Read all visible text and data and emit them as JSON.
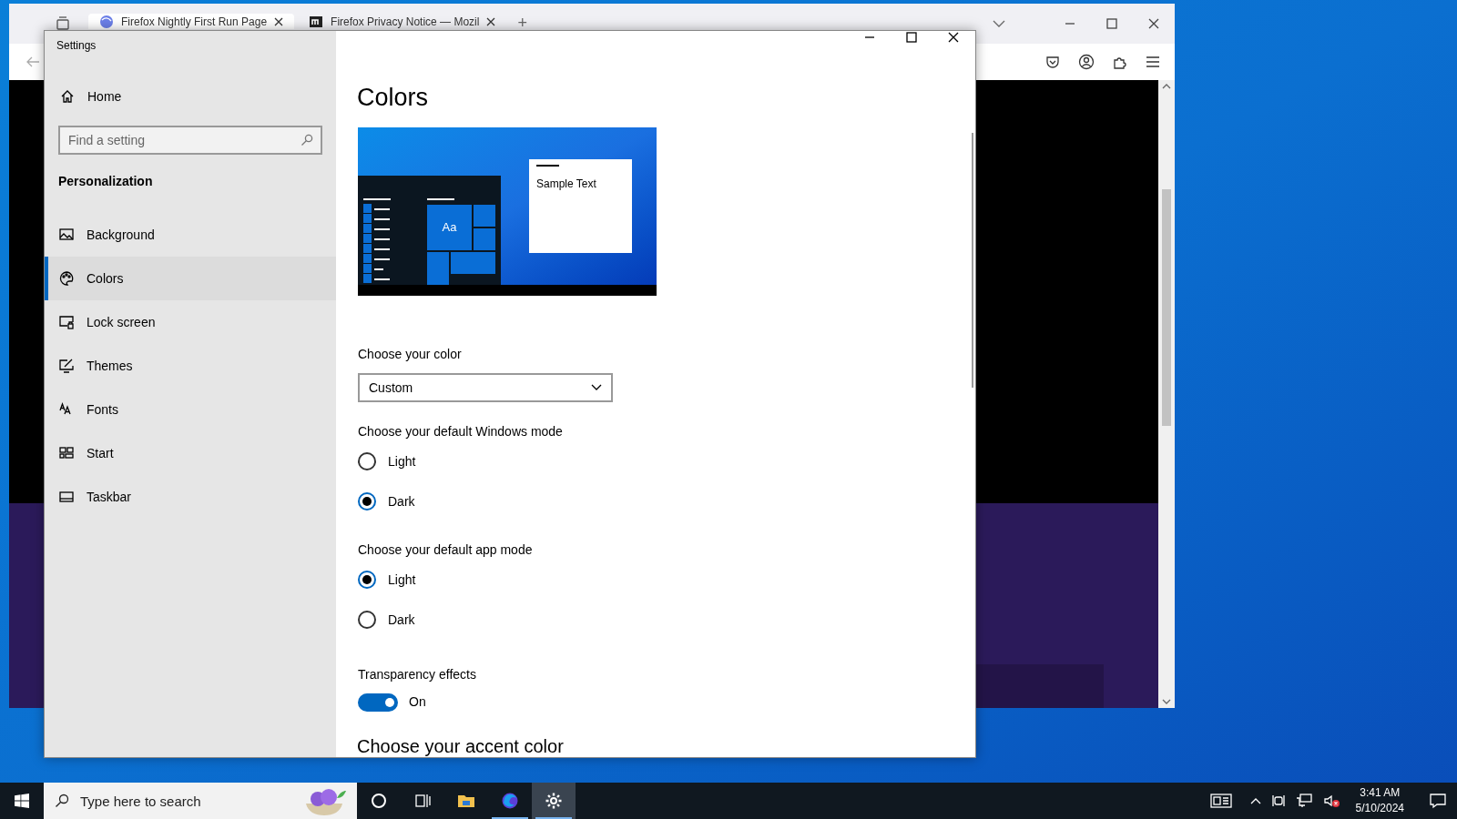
{
  "browser": {
    "tabs": [
      {
        "title": "Firefox Nightly First Run Page",
        "selected": true
      },
      {
        "title": "Firefox Privacy Notice — Mozil",
        "selected": false
      }
    ],
    "new_tab": "+"
  },
  "settings": {
    "title": "Settings",
    "sidebar": {
      "home": "Home",
      "search": {
        "placeholder": "Find a setting"
      },
      "section": "Personalization",
      "items": [
        {
          "label": "Background",
          "kind": "background",
          "selected": false
        },
        {
          "label": "Colors",
          "kind": "colors",
          "selected": true
        },
        {
          "label": "Lock screen",
          "kind": "lock",
          "selected": false
        },
        {
          "label": "Themes",
          "kind": "themes",
          "selected": false
        },
        {
          "label": "Fonts",
          "kind": "fonts",
          "selected": false
        },
        {
          "label": "Start",
          "kind": "start",
          "selected": false
        },
        {
          "label": "Taskbar",
          "kind": "taskbar",
          "selected": false
        }
      ]
    },
    "page": {
      "title": "Colors",
      "preview": {
        "tile_text": "Aa",
        "sample_text": "Sample Text"
      },
      "color_select": {
        "label": "Choose your color",
        "value": "Custom"
      },
      "radio_groups": [
        {
          "label": "Choose your default Windows mode",
          "options": [
            {
              "label": "Light",
              "selected": false
            },
            {
              "label": "Dark",
              "selected": true
            }
          ]
        },
        {
          "label": "Choose your default app mode",
          "options": [
            {
              "label": "Light",
              "selected": true
            },
            {
              "label": "Dark",
              "selected": false
            }
          ]
        }
      ],
      "transparency": {
        "label": "Transparency effects",
        "on": true,
        "state_text": "On"
      },
      "accent_heading": "Choose your accent color"
    }
  },
  "taskbar": {
    "search_placeholder": "Type here to search",
    "apps": [
      {
        "kind": "cortana",
        "running": false,
        "selected": false
      },
      {
        "kind": "taskview",
        "running": false,
        "selected": false
      },
      {
        "kind": "explorer",
        "running": false,
        "selected": false
      },
      {
        "kind": "firefox",
        "running": true,
        "selected": false
      },
      {
        "kind": "settings",
        "running": true,
        "selected": true
      }
    ],
    "time": "3:41 AM",
    "date": "5/10/2024"
  }
}
